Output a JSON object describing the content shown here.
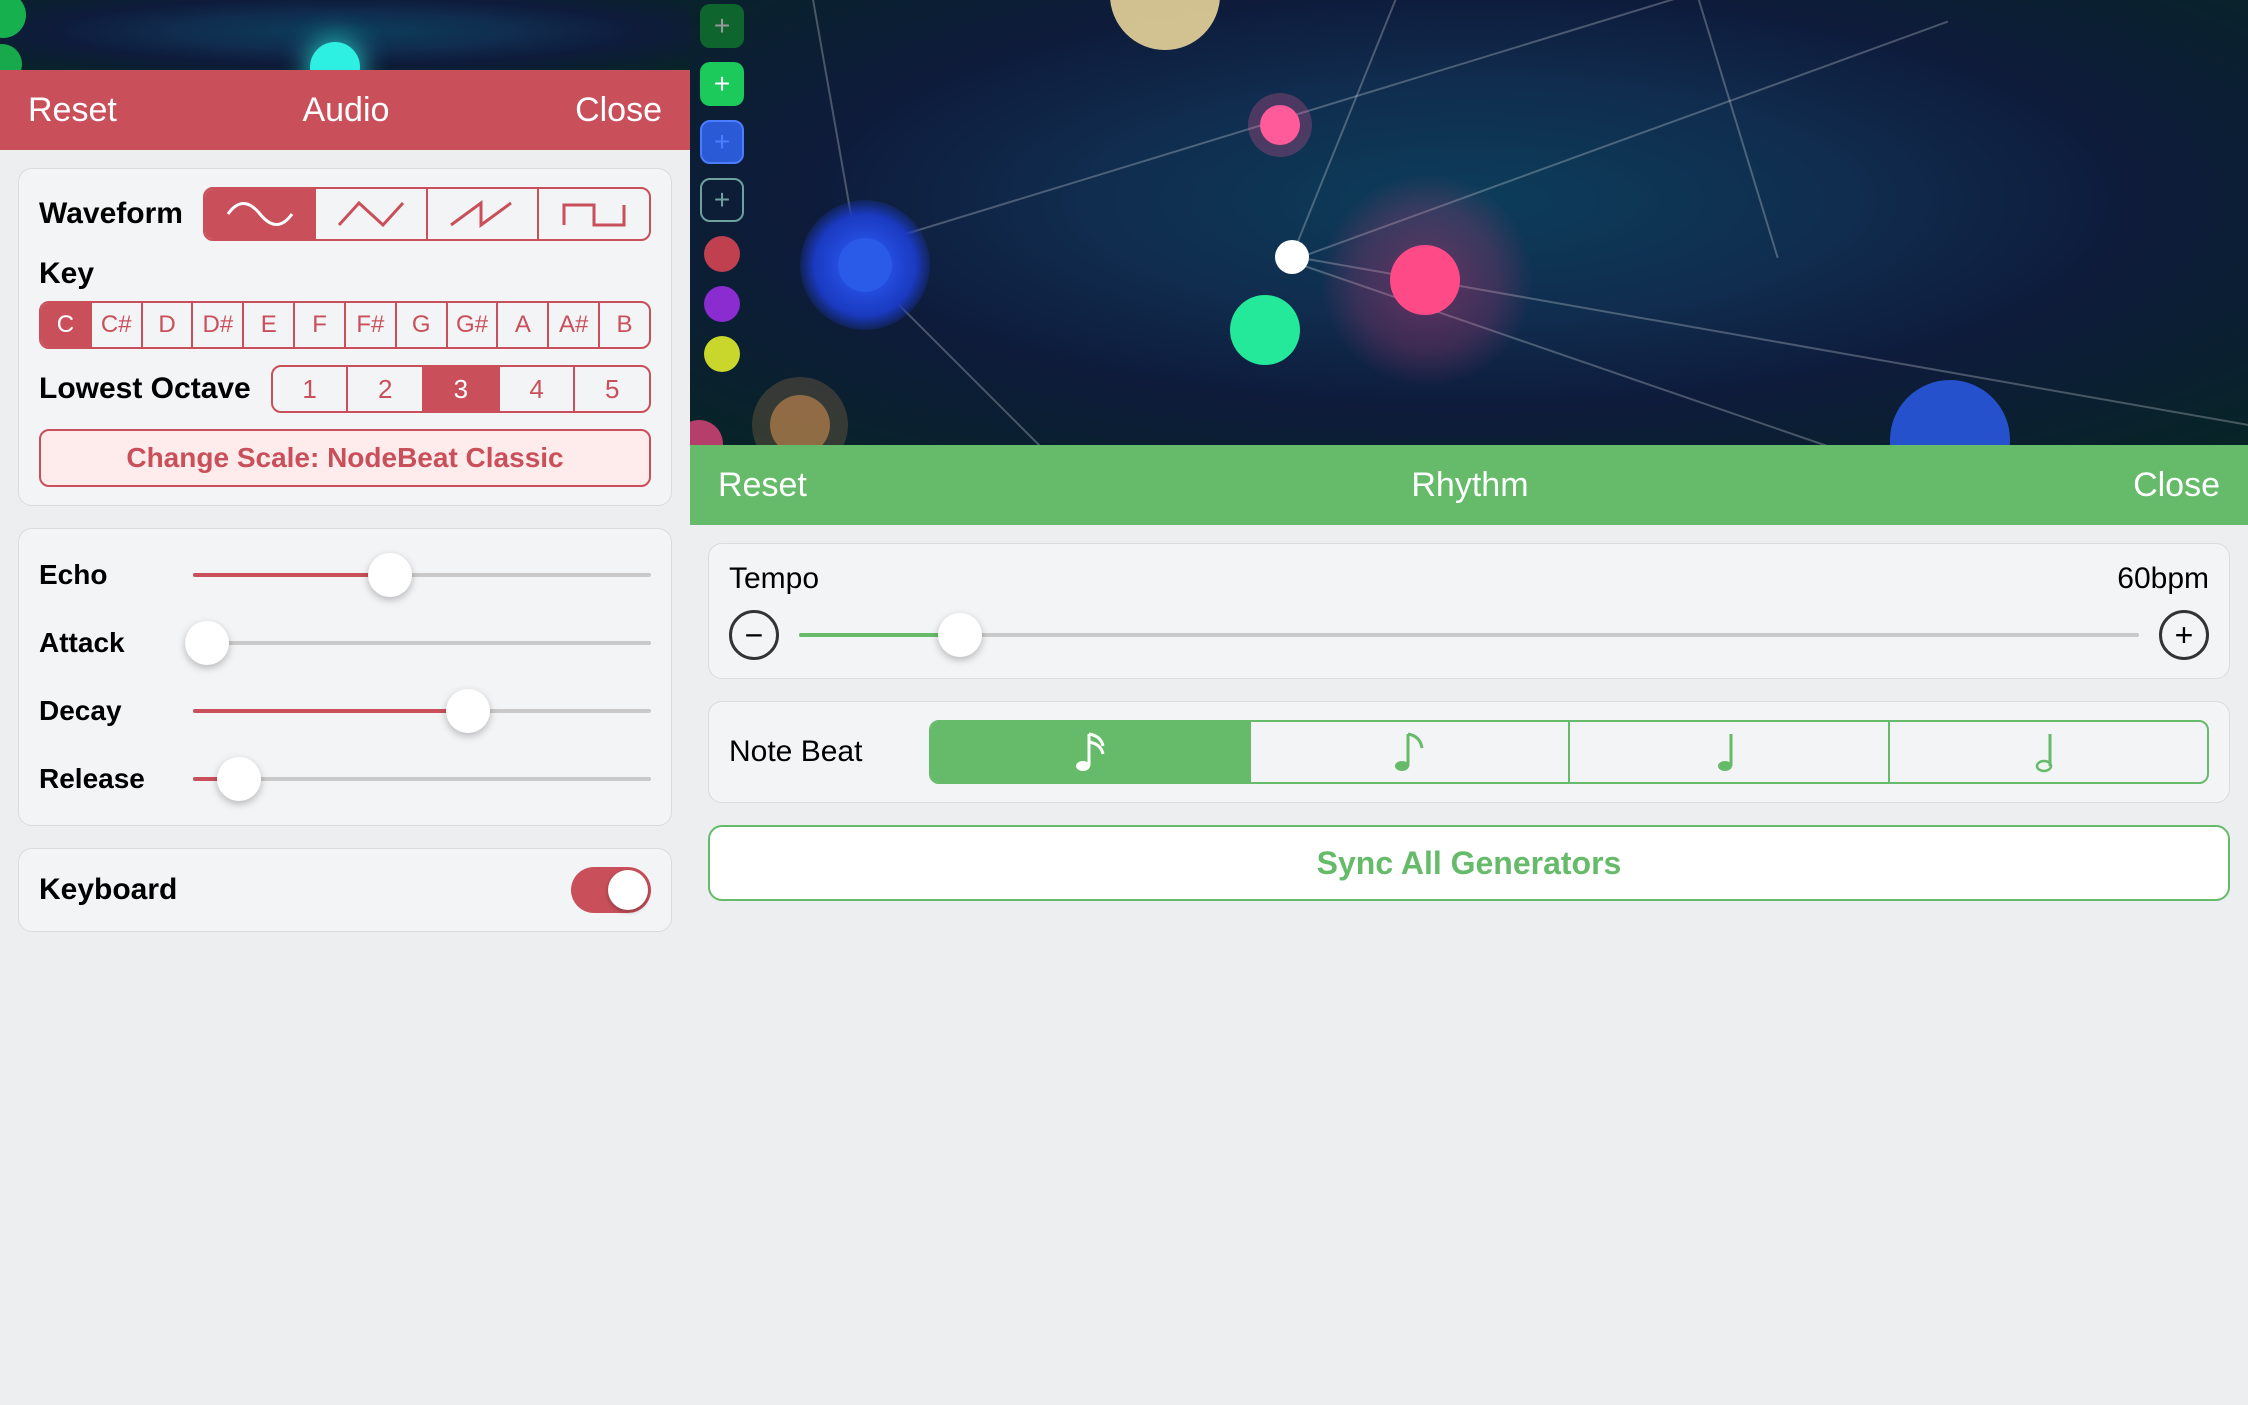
{
  "audio": {
    "header": {
      "left": "Reset",
      "title": "Audio",
      "right": "Close"
    },
    "waveform": {
      "label": "Waveform",
      "options": [
        "sine",
        "triangle",
        "saw",
        "square"
      ],
      "selected": 0
    },
    "key": {
      "label": "Key",
      "options": [
        "C",
        "C#",
        "D",
        "D#",
        "E",
        "F",
        "F#",
        "G",
        "G#",
        "A",
        "A#",
        "B"
      ],
      "selected": 0
    },
    "octave": {
      "label": "Lowest Octave",
      "options": [
        "1",
        "2",
        "3",
        "4",
        "5"
      ],
      "selected": 2
    },
    "scale_button": "Change Scale: NodeBeat Classic",
    "sliders": {
      "echo": {
        "label": "Echo",
        "value": 0.43
      },
      "attack": {
        "label": "Attack",
        "value": 0.03
      },
      "decay": {
        "label": "Decay",
        "value": 0.6
      },
      "release": {
        "label": "Release",
        "value": 0.1
      }
    },
    "keyboard": {
      "label": "Keyboard",
      "on": true
    }
  },
  "rhythm": {
    "header": {
      "left": "Reset",
      "title": "Rhythm",
      "right": "Close"
    },
    "tempo": {
      "label": "Tempo",
      "readout": "60bpm",
      "slider_value": 0.12
    },
    "note_beat": {
      "label": "Note Beat",
      "options": [
        "sixteenth",
        "eighth",
        "quarter",
        "half"
      ],
      "selected": 0
    },
    "sync_button": "Sync All Generators"
  },
  "colors": {
    "red": "#c9505a",
    "green": "#66bb6a"
  }
}
